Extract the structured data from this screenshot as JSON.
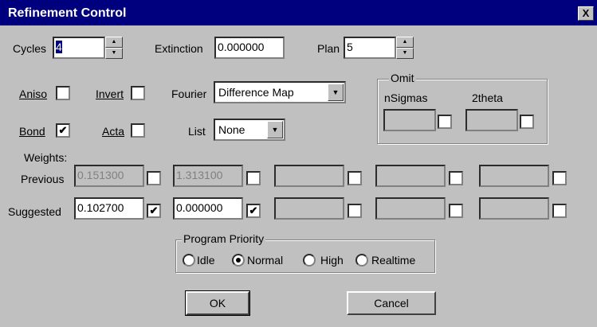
{
  "window": {
    "title": "Refinement Control",
    "close_glyph": "X"
  },
  "cycles": {
    "label": "Cycles",
    "value": "4"
  },
  "extinction": {
    "label": "Extinction",
    "value": "0.000000"
  },
  "plan": {
    "label": "Plan",
    "value": "5"
  },
  "aniso": {
    "label": "Aniso",
    "checked": false
  },
  "invert": {
    "label": "Invert",
    "checked": false
  },
  "bond": {
    "label": "Bond",
    "checked": true
  },
  "acta": {
    "label": "Acta",
    "checked": false
  },
  "fourier": {
    "label": "Fourier",
    "value": "Difference Map"
  },
  "list": {
    "label": "List",
    "value": "None"
  },
  "omit": {
    "title": "Omit",
    "nsigmas_label": "nSigmas",
    "twotheta_label": "2theta",
    "nsigmas_value": "",
    "twotheta_value": ""
  },
  "weights": {
    "label": "Weights:",
    "previous_label": "Previous",
    "suggested_label": "Suggested",
    "previous": [
      "0.151300",
      "1.313100",
      "",
      "",
      ""
    ],
    "previous_checked": [
      false,
      false,
      false,
      false,
      false
    ],
    "suggested": [
      "0.102700",
      "0.000000",
      "",
      "",
      ""
    ],
    "suggested_checked": [
      true,
      true,
      false,
      false,
      false
    ]
  },
  "priority": {
    "title": "Program Priority",
    "options": [
      "Idle",
      "Normal",
      "High",
      "Realtime"
    ],
    "selected": "Normal"
  },
  "buttons": {
    "ok": "OK",
    "cancel": "Cancel"
  },
  "glyphs": {
    "check": "✔",
    "spin_up": "▲",
    "spin_down": "▼",
    "dropdown": "▼"
  }
}
